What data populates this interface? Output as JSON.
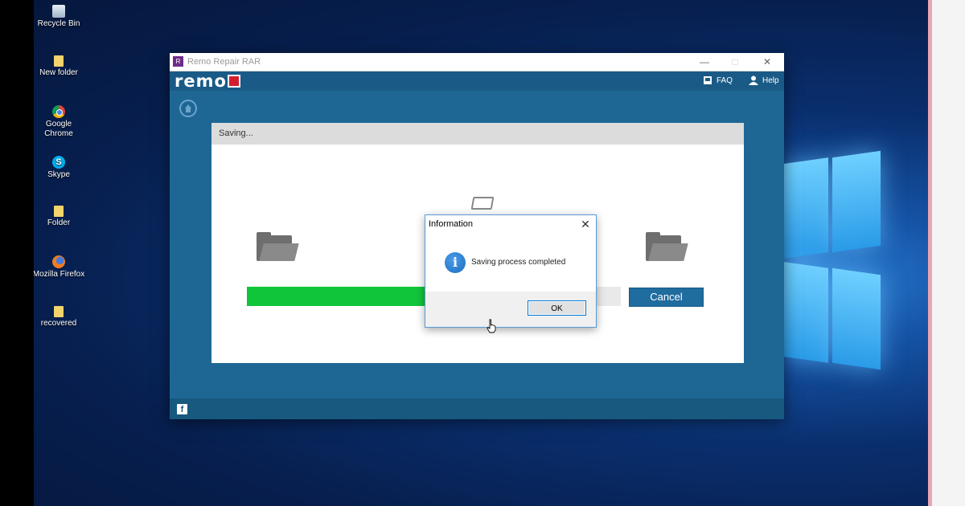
{
  "desktop": {
    "icons": [
      {
        "label": "Recycle Bin",
        "icon": "recycle-bin-icon"
      },
      {
        "label": "New folder",
        "icon": "folder-icon"
      },
      {
        "label": "Google Chrome",
        "icon": "chrome-icon"
      },
      {
        "label": "Skype",
        "icon": "skype-icon"
      },
      {
        "label": "Folder",
        "icon": "folder-icon"
      },
      {
        "label": "Mozilla Firefox",
        "icon": "firefox-icon"
      },
      {
        "label": "recovered",
        "icon": "folder-icon"
      }
    ]
  },
  "app": {
    "title": "Remo Repair RAR",
    "logo_text": "remo",
    "logo_color": "#d41e2f",
    "header_links": [
      {
        "label": "FAQ",
        "icon": "faq-book-icon"
      },
      {
        "label": "Help",
        "icon": "user-help-icon"
      }
    ],
    "window_controls": {
      "minimize": "—",
      "maximize": "□",
      "close": "✕"
    },
    "panel": {
      "heading": "Saving...",
      "progress_fraction": 0.87,
      "progress_color": "#11c53a",
      "cancel_label": "Cancel"
    },
    "footer": {
      "facebook_glyph": "f"
    }
  },
  "dialog": {
    "title": "Information",
    "close_glyph": "✕",
    "message": "Saving process completed",
    "info_glyph": "i",
    "ok_label": "OK"
  }
}
